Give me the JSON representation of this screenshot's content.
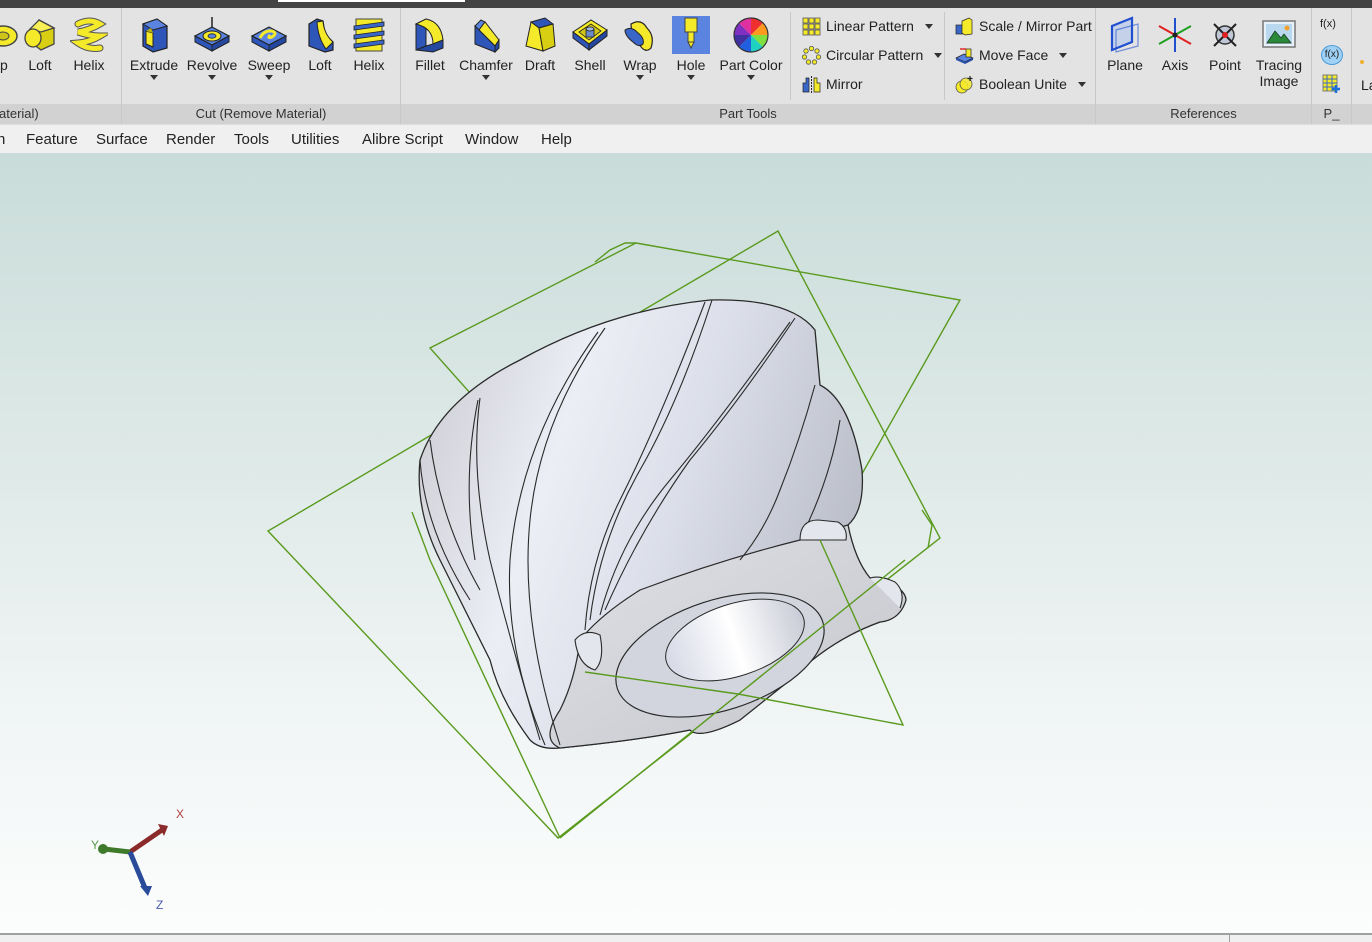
{
  "titlebar": {
    "active_tab": ""
  },
  "ribbon": {
    "groups": [
      {
        "footer": "aterial)",
        "tools": [
          {
            "label": "ep",
            "icon": "boss-sweep-icon"
          },
          {
            "label": "Loft",
            "icon": "boss-loft-icon"
          },
          {
            "label": "Helix",
            "icon": "boss-helix-icon"
          }
        ]
      },
      {
        "footer": "Cut (Remove Material)",
        "tools": [
          {
            "label": "Extrude",
            "icon": "cut-extrude-icon",
            "dropdown": true
          },
          {
            "label": "Revolve",
            "icon": "cut-revolve-icon",
            "dropdown": true
          },
          {
            "label": "Sweep",
            "icon": "cut-sweep-icon",
            "dropdown": true
          },
          {
            "label": "Loft",
            "icon": "cut-loft-icon"
          },
          {
            "label": "Helix",
            "icon": "cut-helix-icon"
          }
        ]
      },
      {
        "footer": "Part Tools",
        "tools": [
          {
            "label": "Fillet",
            "icon": "fillet-icon"
          },
          {
            "label": "Chamfer",
            "icon": "chamfer-icon",
            "dropdown": true
          },
          {
            "label": "Draft",
            "icon": "draft-icon"
          },
          {
            "label": "Shell",
            "icon": "shell-icon"
          },
          {
            "label": "Wrap",
            "icon": "wrap-icon",
            "dropdown": true
          },
          {
            "label": "Hole",
            "icon": "hole-icon",
            "dropdown": true
          },
          {
            "label": "Part Color",
            "icon": "part-color-icon",
            "dropdown": true
          }
        ],
        "small_tools_col1": [
          {
            "label": "Linear Pattern",
            "icon": "linear-pattern-icon",
            "dropdown": true
          },
          {
            "label": "Circular Pattern",
            "icon": "circular-pattern-icon",
            "dropdown": true
          },
          {
            "label": "Mirror",
            "icon": "mirror-icon",
            "dropdown": false
          }
        ],
        "small_tools_col2": [
          {
            "label": "Scale / Mirror Part",
            "icon": "scale-mirror-part-icon",
            "dropdown": false
          },
          {
            "label": "Move Face",
            "icon": "move-face-icon",
            "dropdown": true
          },
          {
            "label": "Boolean Unite",
            "icon": "boolean-unite-icon",
            "dropdown": true
          }
        ]
      },
      {
        "footer": "References",
        "tools": [
          {
            "label": "Plane",
            "icon": "plane-icon"
          },
          {
            "label": "Axis",
            "icon": "axis-icon"
          },
          {
            "label": "Point",
            "icon": "point-icon"
          },
          {
            "label": "Tracing\nImage",
            "label_line1": "Tracing",
            "label_line2": "Image",
            "icon": "tracing-image-icon"
          }
        ]
      },
      {
        "footer": "P_",
        "small_icons": [
          {
            "label": "f(x)",
            "icon": "equation-icon"
          },
          {
            "label": "f(x)",
            "icon": "equation-editor-icon"
          },
          {
            "label": "",
            "icon": "design-table-icon"
          }
        ]
      },
      {
        "footer": "",
        "tools": [
          {
            "label": "La",
            "icon": "layer-icon"
          }
        ]
      }
    ]
  },
  "menubar": {
    "items": [
      "n",
      "Feature",
      "Surface",
      "Render",
      "Tools",
      "Utilities",
      "Alibre Script",
      "Window",
      "Help"
    ]
  },
  "viewport": {
    "triad": {
      "x_label": "X",
      "y_label": "Y",
      "z_label": "Z"
    },
    "colors": {
      "plane_outline": "#5a9a1e",
      "part_surface": "#e4e6ee",
      "part_edge": "#2a2a2a",
      "axis_x": "#8b2a2a",
      "axis_y": "#3e7a2a",
      "axis_z": "#2a4a9a"
    }
  }
}
